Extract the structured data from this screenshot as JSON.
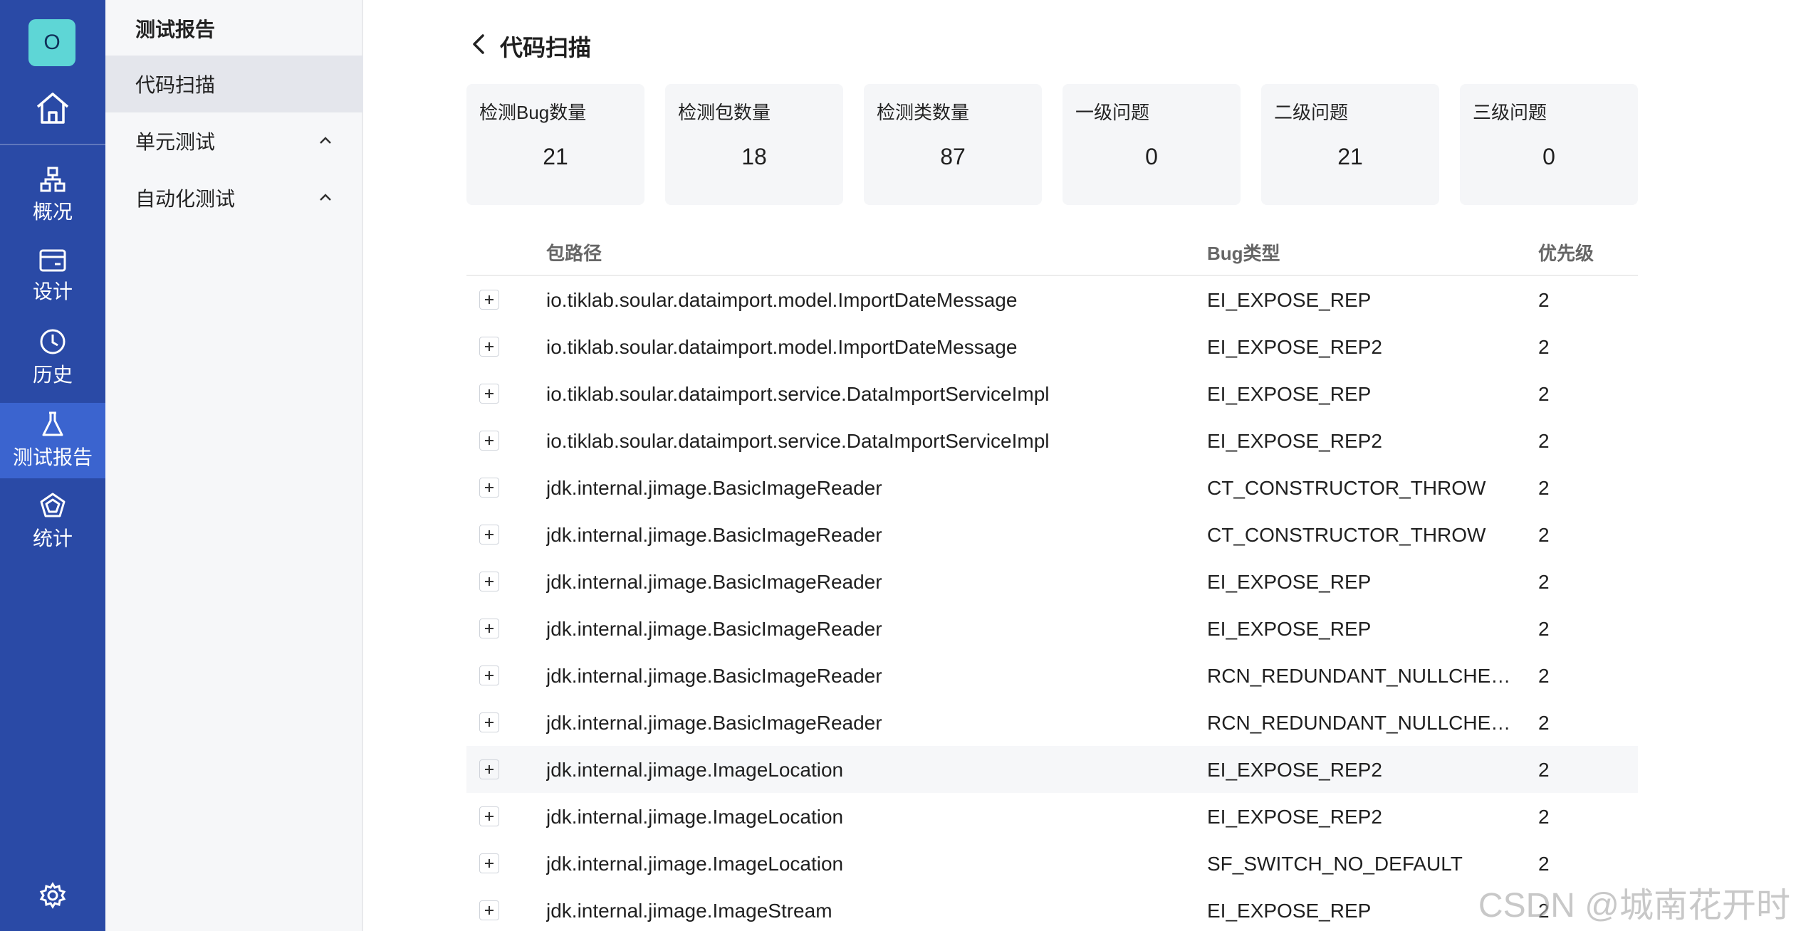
{
  "rail": {
    "avatar_letter": "O",
    "items": [
      {
        "label": "概况",
        "icon": "sitemap-icon"
      },
      {
        "label": "设计",
        "icon": "card-icon"
      },
      {
        "label": "历史",
        "icon": "clock-icon"
      },
      {
        "label": "测试报告",
        "icon": "flask-icon"
      },
      {
        "label": "统计",
        "icon": "chart-icon"
      }
    ],
    "active_index": 3
  },
  "subnav": {
    "title": "测试报告",
    "items": [
      {
        "label": "代码扫描"
      },
      {
        "label": "单元测试"
      },
      {
        "label": "自动化测试"
      }
    ]
  },
  "page": {
    "title": "代码扫描"
  },
  "stats": [
    {
      "label": "检测Bug数量",
      "value": "21"
    },
    {
      "label": "检测包数量",
      "value": "18"
    },
    {
      "label": "检测类数量",
      "value": "87"
    },
    {
      "label": "一级问题",
      "value": "0"
    },
    {
      "label": "二级问题",
      "value": "21"
    },
    {
      "label": "三级问题",
      "value": "0"
    }
  ],
  "table": {
    "columns": [
      "包路径",
      "Bug类型",
      "优先级"
    ],
    "rows": [
      {
        "path": "io.tiklab.soular.dataimport.model.ImportDateMessage",
        "bug": "EI_EXPOSE_REP",
        "priority": "2"
      },
      {
        "path": "io.tiklab.soular.dataimport.model.ImportDateMessage",
        "bug": "EI_EXPOSE_REP2",
        "priority": "2"
      },
      {
        "path": "io.tiklab.soular.dataimport.service.DataImportServiceImpl",
        "bug": "EI_EXPOSE_REP",
        "priority": "2"
      },
      {
        "path": "io.tiklab.soular.dataimport.service.DataImportServiceImpl",
        "bug": "EI_EXPOSE_REP2",
        "priority": "2"
      },
      {
        "path": "jdk.internal.jimage.BasicImageReader",
        "bug": "CT_CONSTRUCTOR_THROW",
        "priority": "2"
      },
      {
        "path": "jdk.internal.jimage.BasicImageReader",
        "bug": "CT_CONSTRUCTOR_THROW",
        "priority": "2"
      },
      {
        "path": "jdk.internal.jimage.BasicImageReader",
        "bug": "EI_EXPOSE_REP",
        "priority": "2"
      },
      {
        "path": "jdk.internal.jimage.BasicImageReader",
        "bug": "EI_EXPOSE_REP",
        "priority": "2"
      },
      {
        "path": "jdk.internal.jimage.BasicImageReader",
        "bug": "RCN_REDUNDANT_NULLCHEC...",
        "priority": "2"
      },
      {
        "path": "jdk.internal.jimage.BasicImageReader",
        "bug": "RCN_REDUNDANT_NULLCHEC...",
        "priority": "2"
      },
      {
        "path": "jdk.internal.jimage.ImageLocation",
        "bug": "EI_EXPOSE_REP2",
        "priority": "2"
      },
      {
        "path": "jdk.internal.jimage.ImageLocation",
        "bug": "EI_EXPOSE_REP2",
        "priority": "2"
      },
      {
        "path": "jdk.internal.jimage.ImageLocation",
        "bug": "SF_SWITCH_NO_DEFAULT",
        "priority": "2"
      },
      {
        "path": "jdk.internal.jimage.ImageStream",
        "bug": "EI_EXPOSE_REP",
        "priority": "2"
      }
    ]
  },
  "watermark": "CSDN @城南花开时",
  "colors": {
    "rail": "#2a4aa6",
    "rail_active": "#3b64cf",
    "avatar": "#5ed6d6"
  }
}
